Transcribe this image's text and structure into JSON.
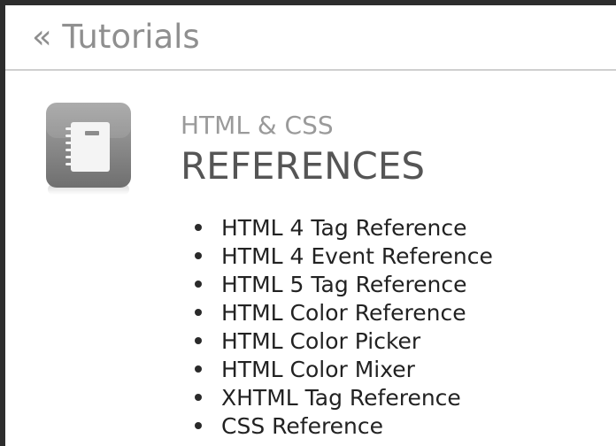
{
  "breadcrumb": {
    "back_label": "« Tutorials"
  },
  "section": {
    "icon": "notebook-icon",
    "subtitle": "HTML & CSS",
    "title": "REFERENCES"
  },
  "references": [
    "HTML 4 Tag Reference",
    "HTML 4 Event Reference",
    "HTML 5 Tag Reference",
    "HTML Color Reference",
    "HTML Color Picker",
    "HTML Color Mixer",
    "XHTML Tag Reference",
    "CSS Reference"
  ],
  "colors": {
    "breadcrumb": "#8f8f8f",
    "subtitle": "#9a9a9a",
    "title": "#555555",
    "link": "#222222"
  }
}
